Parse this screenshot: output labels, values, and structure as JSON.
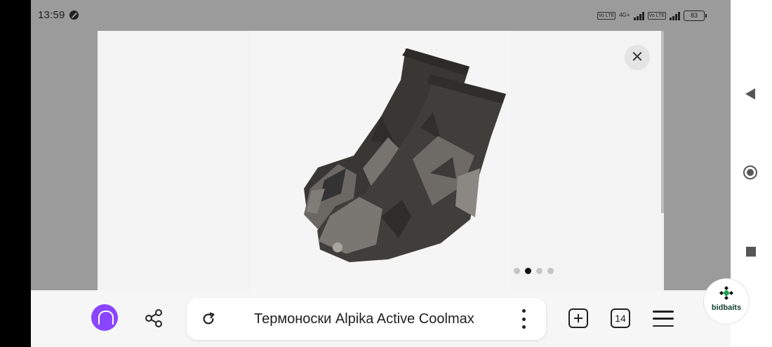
{
  "statusbar": {
    "time": "13:59",
    "network_badge": "Vo LTE",
    "network_label": "4G+",
    "battery": "83"
  },
  "viewer": {
    "title": "Термоноски Alpika Active Coolmax",
    "tabs_count": "14",
    "dots": [
      false,
      true,
      false,
      false
    ]
  },
  "icons": {
    "close": "close-icon",
    "share": "share-icon",
    "reload": "reload-icon",
    "menu": "menu-icon",
    "new_tab": "plus-tab-icon",
    "back": "back-icon",
    "home": "home-icon",
    "recents": "recents-icon"
  },
  "brand": {
    "logo_text": "bidbaits",
    "accent": "#8a45ff"
  }
}
